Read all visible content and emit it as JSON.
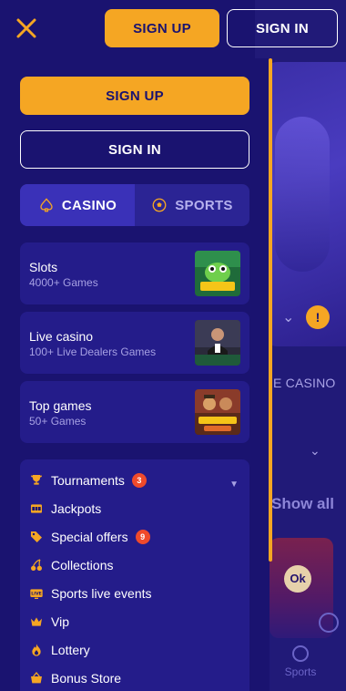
{
  "header": {
    "signup_label": "SIGN UP",
    "signin_label": "SIGN IN"
  },
  "drawer": {
    "signup_label": "SIGN UP",
    "signin_label": "SIGN IN",
    "tabs": [
      {
        "label": "CASINO",
        "icon": "spade-icon",
        "active": true
      },
      {
        "label": "SPORTS",
        "icon": "soccer-ball-icon",
        "active": false
      }
    ],
    "categories": [
      {
        "title": "Slots",
        "subtitle": "4000+ Games",
        "thumb": "elvis-frog-thumbnail"
      },
      {
        "title": "Live casino",
        "subtitle": "100+ Live Dealers Games",
        "thumb": "live-dealer-thumbnail"
      },
      {
        "title": "Top games",
        "subtitle": "50+ Games",
        "thumb": "john-hunter-thumbnail"
      }
    ],
    "menu": [
      {
        "label": "Tournaments",
        "icon": "trophy-icon",
        "badge": "3"
      },
      {
        "label": "Jackpots",
        "icon": "jackpot-icon",
        "badge": ""
      },
      {
        "label": "Special offers",
        "icon": "tag-icon",
        "badge": "9"
      },
      {
        "label": "Collections",
        "icon": "cherries-icon",
        "badge": ""
      },
      {
        "label": "Sports live events",
        "icon": "live-tv-icon",
        "badge": ""
      },
      {
        "label": "Vip",
        "icon": "crown-icon",
        "badge": ""
      },
      {
        "label": "Lottery",
        "icon": "flame-icon",
        "badge": ""
      },
      {
        "label": "Bonus Store",
        "icon": "basket-icon",
        "badge": ""
      }
    ]
  },
  "background": {
    "casino_label": "E CASINO",
    "show_all_label": "Show all",
    "ok_label": "Ok",
    "sports_tab_label": "Sports"
  },
  "colors": {
    "accent": "#f5a623",
    "bg": "#1a1370",
    "card": "#241c8a",
    "badge": "#ef4a2b"
  }
}
